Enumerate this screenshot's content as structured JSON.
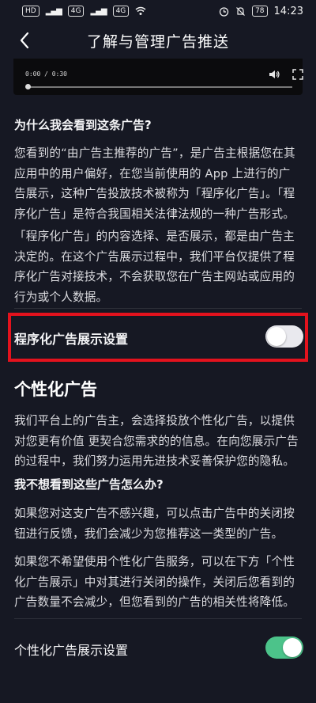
{
  "status_bar": {
    "left_tags": [
      "HD",
      "4G",
      "4G"
    ],
    "battery": "78",
    "time": "14:23"
  },
  "header": {
    "title": "了解与管理广告推送",
    "back_icon": "chevron-left-icon"
  },
  "video": {
    "time": "0:00 / 0:30",
    "progress": 0
  },
  "content": {
    "q1": "为什么我会看到这条广告?",
    "p1": "您看到的“由广告主推荐的广告”，是广告主根据您在其应用中的用户偏好，在您当前使用的 App 上进行的广告展示，这种广告投放技术被称为「程序化广告」。「程序化广告」是符合我国相关法律法规的一种广告形式。",
    "p2": "「程序化广告」的内容选择、是否展示，都是由广告主决定的。在这个广告展示过程中，我们平台仅提供了程序化广告对接技术，不会获取您在广告主网站或应用的行为或个人数据。",
    "programmatic_setting_label": "程序化广告展示设置",
    "programmatic_toggle_on": false,
    "section_title": "个性化广告",
    "p3": "我们平台上的广告主，会选择投放个性化广告，以提供对您更有价值 更契合您需求的的信息。在向您展示广告的过程中，我们努力运用先进技术妥善保护您的隐私。",
    "q2": "我不想看到这些广告怎么办?",
    "p4": "如果您对这支广告不感兴趣，可以点击广告中的关闭按钮进行反馈，我们会减少为您推荐这一类型的广告。",
    "p5": "如果您不希望使用个性化广告服务，可以在下方「个性化广告展示」中对其进行关闭的操作，关闭后您看到的广告数量不会减少，但您看到的广告的相关性将降低。",
    "personalized_setting_label": "个性化广告展示设置",
    "personalized_toggle_on": true
  },
  "colors": {
    "background": "#161823",
    "highlight": "#e3121d",
    "toggle_on": "#4cc38a",
    "toggle_off": "#e9e9ee"
  }
}
